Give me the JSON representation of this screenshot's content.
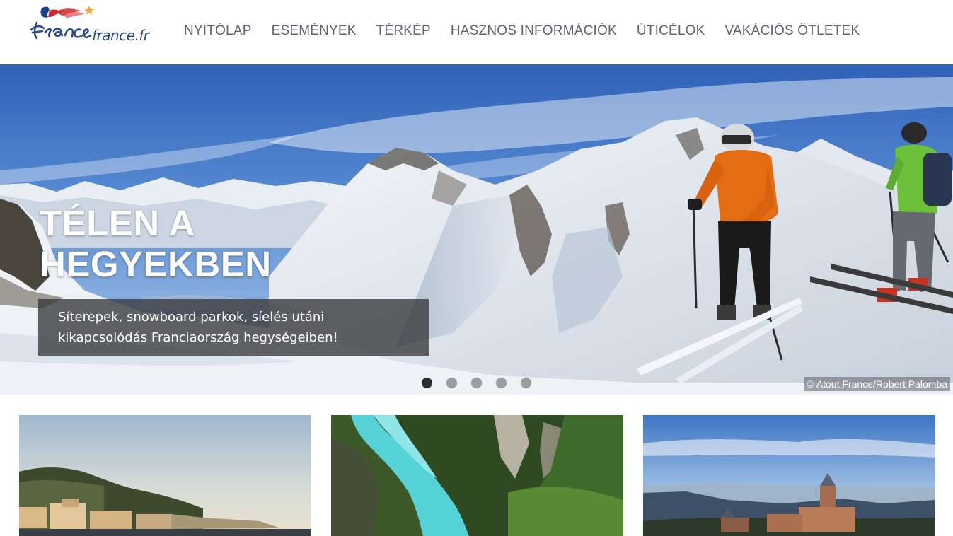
{
  "brand": {
    "logo_word": "france",
    "domain": "france.fr"
  },
  "nav": {
    "items": [
      {
        "label": "NYITÓLAP"
      },
      {
        "label": "ESEMÉNYEK"
      },
      {
        "label": "TÉRKÉP"
      },
      {
        "label": "HASZNOS INFORMÁCIÓK"
      },
      {
        "label": "ÚTICÉLOK"
      },
      {
        "label": "VAKÁCIÓS ÖTLETEK"
      }
    ]
  },
  "hero": {
    "title_line1": "TÉLEN A",
    "title_line2": "HEGYEKBEN",
    "caption_line1": "Síterepek, snowboard parkok, síelés utáni",
    "caption_line2": "kikapcsolódás Franciaország hegységeiben!",
    "credit": "© Atout France/Robert Palomba",
    "slides_total": 5,
    "active_slide": 1
  },
  "colors": {
    "nav_text": "#5e6469",
    "brand_blue": "#2a4a8c",
    "caption_bg": "#37373a",
    "dot_active": "#2d2d2f",
    "dot_inactive": "#9b9da1"
  },
  "icons": {
    "logo": "france-marianne-logo-icon"
  }
}
